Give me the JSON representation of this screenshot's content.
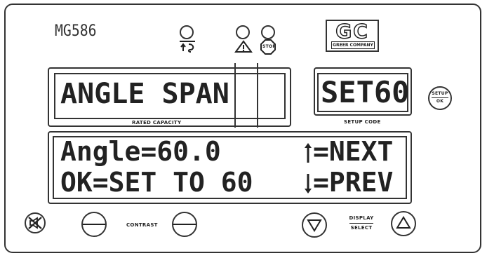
{
  "device": {
    "model": "MG586",
    "brand_logo": "GC",
    "brand_name": "GREER COMPANY"
  },
  "indicators": {
    "anti_two_block_icon": "anti-two-block-icon",
    "warning_icon": "warning-triangle-icon",
    "stop_label": "STOP"
  },
  "display_top": {
    "main_text": "ANGLE SPAN",
    "main_caption": "RATED CAPACITY",
    "setup_text": "SET60",
    "setup_caption": "SETUP CODE"
  },
  "setup_ok_button": {
    "line1": "SETUP",
    "line2": "OK"
  },
  "display_bottom": {
    "line1_left": "Angle=60.0",
    "line1_right": "=NEXT",
    "line2_left": "OK=SET TO 60",
    "line2_right": "=PREV"
  },
  "controls": {
    "contrast_label": "CONTRAST",
    "display_label": "DISPLAY",
    "select_label": "SELECT"
  }
}
